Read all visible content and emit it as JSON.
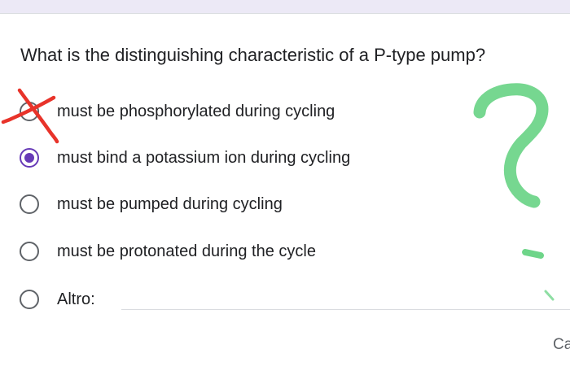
{
  "question": {
    "text": "What is the distinguishing characteristic of a P-type pump?"
  },
  "options": [
    {
      "label": "must be phosphorylated during cycling",
      "selected": false,
      "crossed_out": true
    },
    {
      "label": "must bind a potassium ion during cycling",
      "selected": true
    },
    {
      "label": "must be pumped during cycling",
      "selected": false
    },
    {
      "label": "must be protonated during the cycle",
      "selected": false
    }
  ],
  "other_option": {
    "label": "Altro:",
    "value": ""
  },
  "footer": {
    "cancel_label": "Ca"
  },
  "annotations": {
    "cross_mark_color": "#e8332a",
    "question_mark_color": "#5ed07c"
  },
  "colors": {
    "accent": "#673ab7",
    "radio_border": "#5f6368",
    "text": "#202124"
  }
}
